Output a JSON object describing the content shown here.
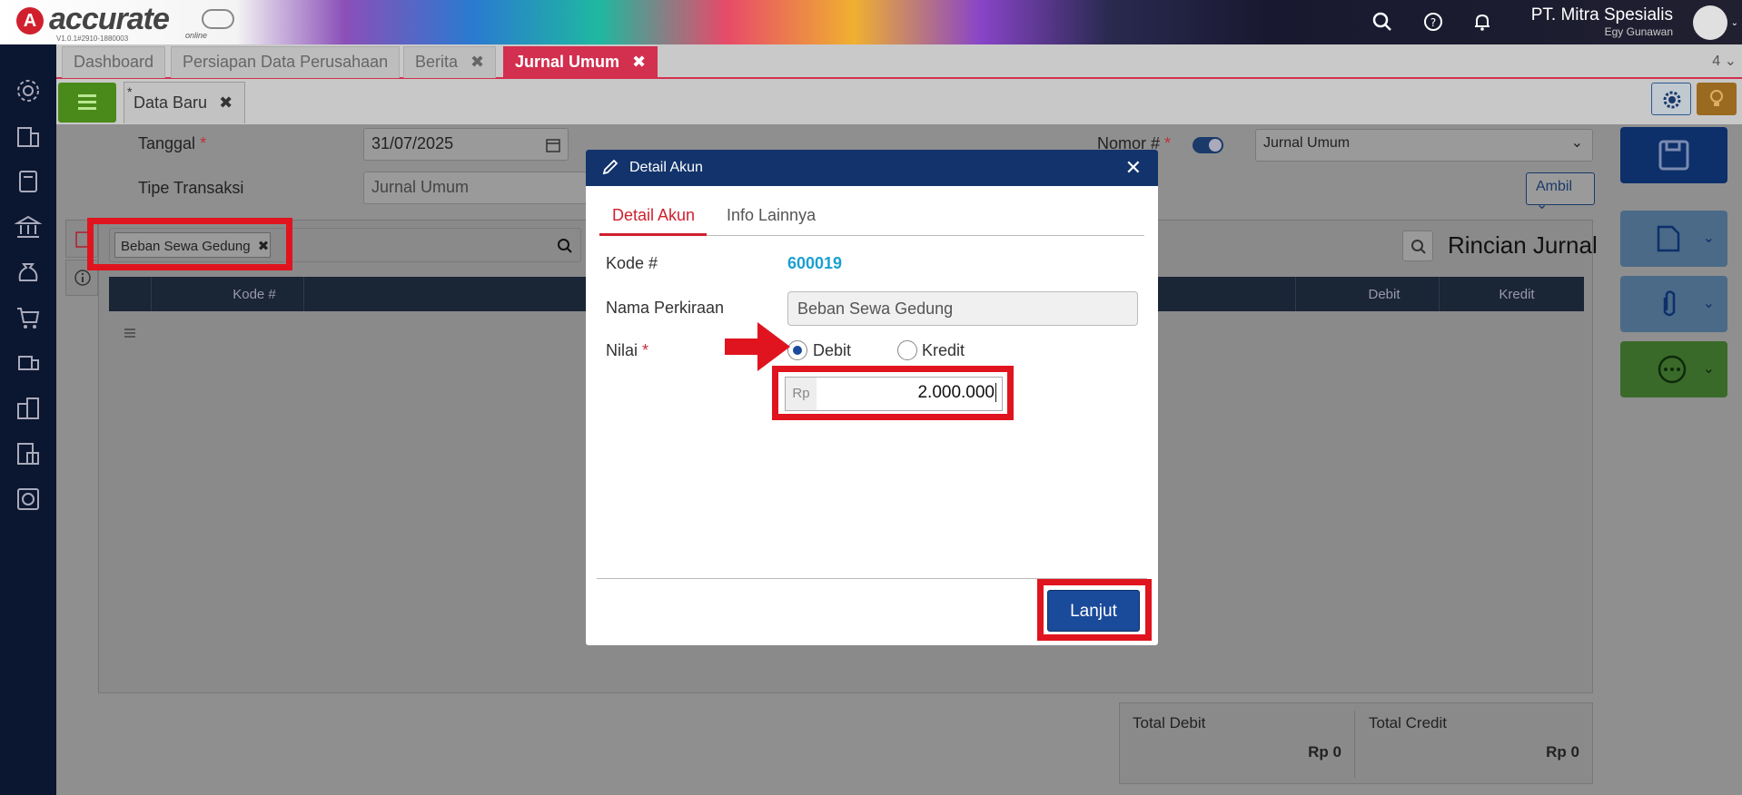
{
  "app": {
    "logo_letter": "A",
    "logo_text": "accurate",
    "logo_online": "online",
    "version": "V1.0.1#2910-1880003",
    "company_name": "PT. Mitra Spesialis",
    "user_name": "Egy Gunawan"
  },
  "tabs": [
    {
      "label": "Dashboard"
    },
    {
      "label": "Persiapan Data Perusahaan"
    },
    {
      "label": "Berita",
      "close": "✖"
    },
    {
      "label": "Jurnal Umum",
      "close": "✖"
    }
  ],
  "tabs_count": "4",
  "subtab": {
    "star": "*",
    "label": "Data Baru",
    "close": "✖"
  },
  "form": {
    "tanggal_label": "Tanggal",
    "tanggal_value": "31/07/2025",
    "tipe_label": "Tipe Transaksi",
    "tipe_value": "Jurnal Umum",
    "nomor_label": "Nomor #",
    "nomor_select": "Jurnal Umum",
    "ambil_label": "Ambil",
    "required_mark": "*"
  },
  "search_chip": {
    "label": "Beban Sewa Gedung",
    "close": "✖"
  },
  "table": {
    "columns": [
      "Kode #",
      "Debit",
      "Kredit"
    ],
    "title": "Rincian Jurnal"
  },
  "totals": {
    "debit_label": "Total Debit",
    "debit_value": "Rp 0",
    "credit_label": "Total Credit",
    "credit_value": "Rp 0"
  },
  "modal": {
    "title": "Detail Akun",
    "close": "✕",
    "tab_active": "Detail Akun",
    "tab_other": "Info Lainnya",
    "kode_label": "Kode #",
    "kode_value": "600019",
    "nama_label": "Nama Perkiraan",
    "nama_value": "Beban Sewa Gedung",
    "nilai_label": "Nilai",
    "required_mark": "*",
    "radio_debit": "Debit",
    "radio_kredit": "Kredit",
    "selected": "Debit",
    "currency_prefix": "Rp",
    "amount_value": "2.000.000",
    "submit_label": "Lanjut"
  },
  "colors": {
    "primary": "#12336b",
    "accent_red": "#d32f4f",
    "highlight": "#e0141e",
    "link": "#1aa0d0"
  }
}
